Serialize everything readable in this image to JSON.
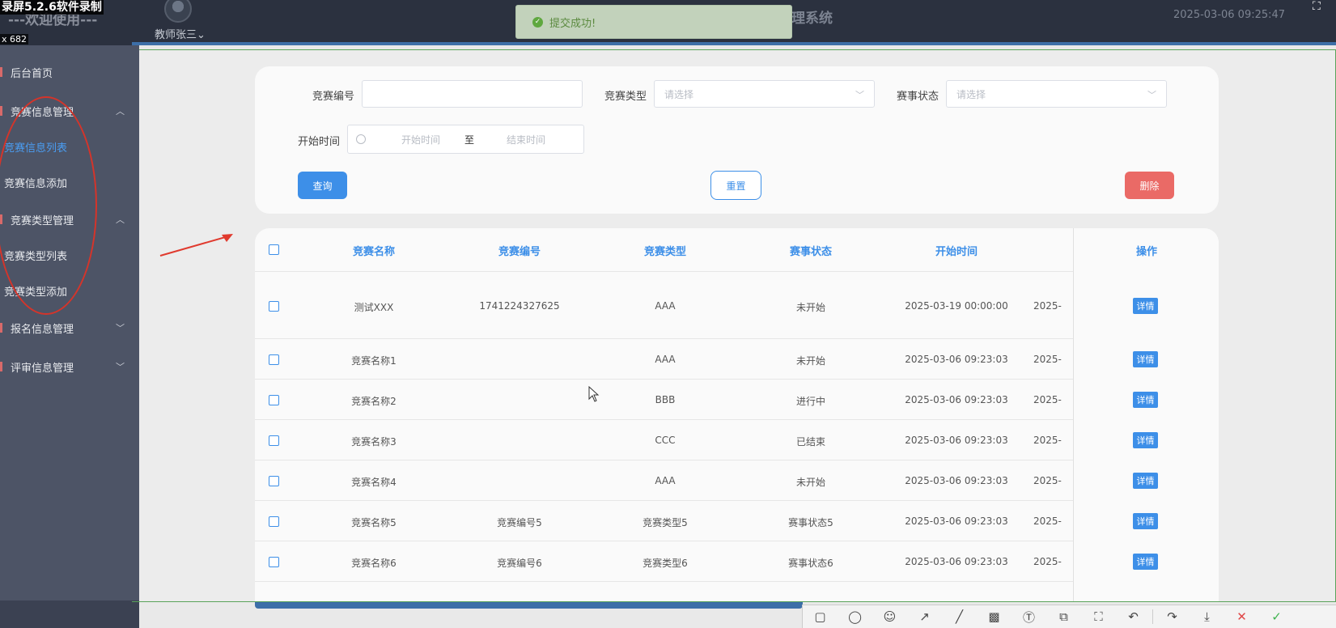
{
  "recorder": {
    "title": "录屏5.2.6软件录制",
    "dims": "x 682"
  },
  "header": {
    "welcome": "---欢迎使用---",
    "user": "教师张三",
    "system_title": "理系统",
    "datetime": "2025-03-06 09:25:47"
  },
  "toast": {
    "message": "提交成功!"
  },
  "sidebar": {
    "home": "后台首页",
    "group1": "竞赛信息管理",
    "group1_items": [
      "竞赛信息列表",
      "竞赛信息添加"
    ],
    "group2": "竞赛类型管理",
    "group2_items": [
      "竞赛类型列表",
      "竞赛类型添加"
    ],
    "group3": "报名信息管理",
    "group4": "评审信息管理"
  },
  "search": {
    "code_label": "竞赛编号",
    "code_value": "",
    "type_label": "竞赛类型",
    "type_placeholder": "请选择",
    "status_label": "赛事状态",
    "status_placeholder": "请选择",
    "time_label": "开始时间",
    "start_placeholder": "开始时间",
    "range_sep": "至",
    "end_placeholder": "结束时间",
    "query_label": "查询",
    "reset_label": "重置",
    "delete_label": "删除"
  },
  "table": {
    "headers": [
      "竞赛名称",
      "竞赛编号",
      "竞赛类型",
      "赛事状态",
      "开始时间",
      "操作"
    ],
    "detail_label": "详情",
    "rows": [
      {
        "name": "测试XXX",
        "code": "1741224327625",
        "type": "AAA",
        "status": "未开始",
        "start": "2025-03-19 00:00:00",
        "end": "2025-"
      },
      {
        "name": "竞赛名称1",
        "code": "",
        "type": "AAA",
        "status": "未开始",
        "start": "2025-03-06 09:23:03",
        "end": "2025-"
      },
      {
        "name": "竞赛名称2",
        "code": "",
        "type": "BBB",
        "status": "进行中",
        "start": "2025-03-06 09:23:03",
        "end": "2025-"
      },
      {
        "name": "竞赛名称3",
        "code": "",
        "type": "CCC",
        "status": "已结束",
        "start": "2025-03-06 09:23:03",
        "end": "2025-"
      },
      {
        "name": "竞赛名称4",
        "code": "",
        "type": "AAA",
        "status": "未开始",
        "start": "2025-03-06 09:23:03",
        "end": "2025-"
      },
      {
        "name": "竞赛名称5",
        "code": "竞赛编号5",
        "type": "竞赛类型5",
        "status": "赛事状态5",
        "start": "2025-03-06 09:23:03",
        "end": "2025-"
      },
      {
        "name": "竞赛名称6",
        "code": "竞赛编号6",
        "type": "竞赛类型6",
        "status": "赛事状态6",
        "start": "2025-03-06 09:23:03",
        "end": "2025-"
      }
    ]
  },
  "toolbar": {
    "tools": [
      "rectangle-icon",
      "ellipse-icon",
      "emoji-icon",
      "arrow-icon",
      "pen-icon",
      "mosaic-icon",
      "text-icon",
      "pin-icon",
      "ocr-icon",
      "undo-icon",
      "redo-icon",
      "save-icon",
      "cancel-icon",
      "confirm-icon"
    ]
  }
}
